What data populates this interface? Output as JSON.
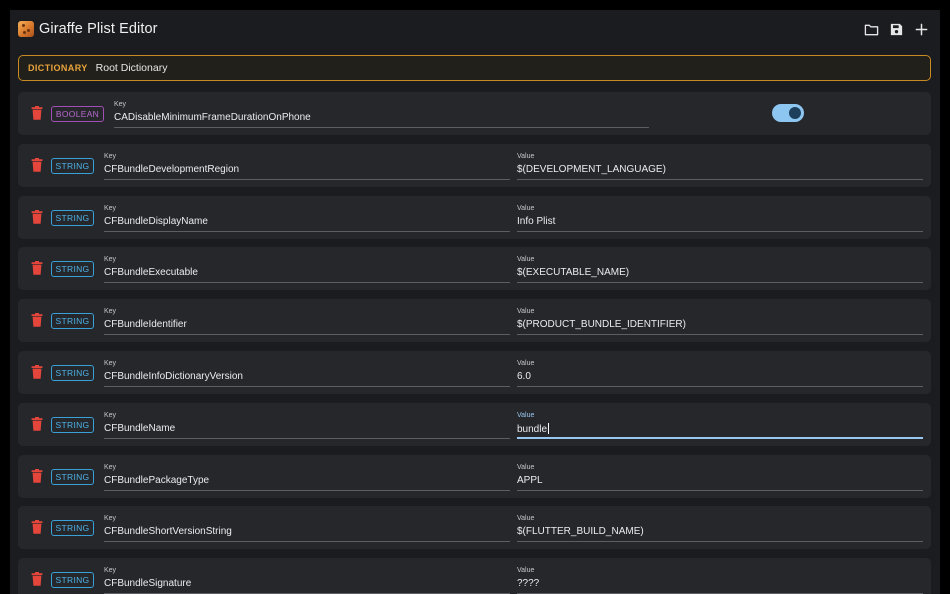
{
  "app": {
    "title": "Giraffe Plist Editor"
  },
  "toolbar": {
    "open_icon": "folder-icon",
    "save_icon": "save-icon",
    "add_icon": "plus-icon"
  },
  "root": {
    "type": "DICTIONARY",
    "name": "Root Dictionary"
  },
  "colors": {
    "string_badge": "#3aa0d8",
    "boolean_badge": "#a14fb6",
    "dictionary_accent": "#c98a22",
    "delete_icon": "#e5463b",
    "toggle_on": "#8ec6f2"
  },
  "labels": {
    "key": "Key",
    "value": "Value"
  },
  "entries": [
    {
      "type": "BOOLEAN",
      "key": "CADisableMinimumFrameDurationOnPhone",
      "value": true
    },
    {
      "type": "STRING",
      "key": "CFBundleDevelopmentRegion",
      "value": "$(DEVELOPMENT_LANGUAGE)"
    },
    {
      "type": "STRING",
      "key": "CFBundleDisplayName",
      "value": "Info Plist"
    },
    {
      "type": "STRING",
      "key": "CFBundleExecutable",
      "value": "$(EXECUTABLE_NAME)"
    },
    {
      "type": "STRING",
      "key": "CFBundleIdentifier",
      "value": "$(PRODUCT_BUNDLE_IDENTIFIER)"
    },
    {
      "type": "STRING",
      "key": "CFBundleInfoDictionaryVersion",
      "value": "6.0"
    },
    {
      "type": "STRING",
      "key": "CFBundleName",
      "value": "bundle",
      "focused": true
    },
    {
      "type": "STRING",
      "key": "CFBundlePackageType",
      "value": "APPL"
    },
    {
      "type": "STRING",
      "key": "CFBundleShortVersionString",
      "value": "$(FLUTTER_BUILD_NAME)"
    },
    {
      "type": "STRING",
      "key": "CFBundleSignature",
      "value": "????"
    }
  ]
}
